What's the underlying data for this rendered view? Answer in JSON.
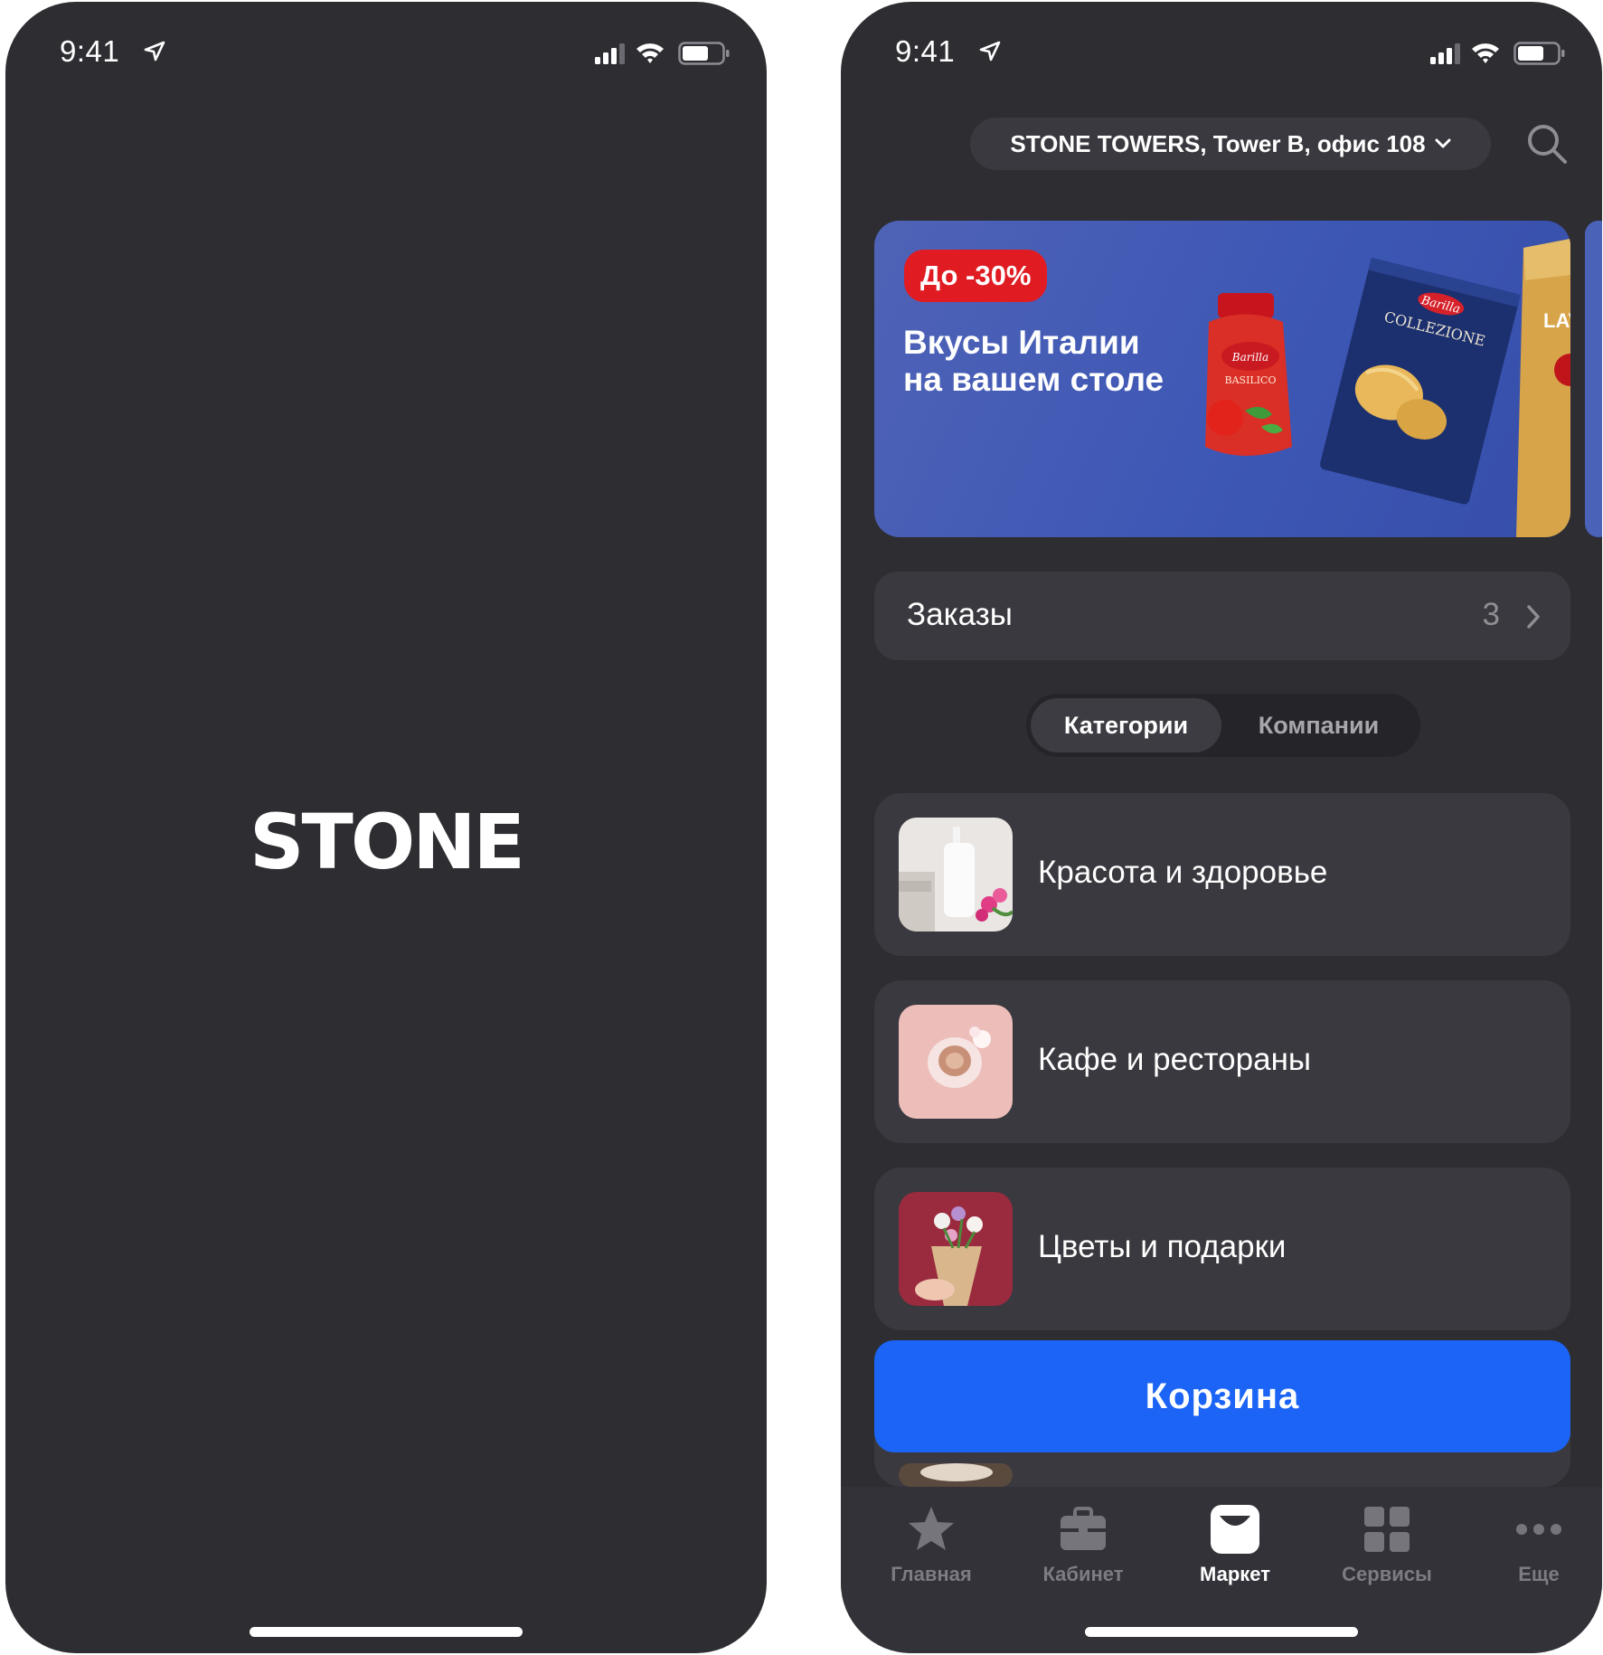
{
  "status_bar": {
    "time": "9:41"
  },
  "splash": {
    "logo_text": "STONE"
  },
  "market": {
    "address": "STONE TOWERS, Tower B, офис 108",
    "banner": {
      "badge": "До -30%",
      "title_line1": "Вкусы Италии",
      "title_line2": "на вашем столе",
      "product_labels": [
        "Barilla",
        "BASILICO",
        "COLLEZIONE",
        "LAV"
      ]
    },
    "orders": {
      "label": "Заказы",
      "count": "3"
    },
    "segments": {
      "active": "Категории",
      "inactive": "Компании"
    },
    "categories": [
      {
        "label": "Красота и здоровье"
      },
      {
        "label": "Кафе и рестораны"
      },
      {
        "label": "Цветы и подарки"
      }
    ],
    "cart_button": "Корзина"
  },
  "tab_bar": {
    "items": [
      {
        "label": "Главная",
        "icon": "star-icon"
      },
      {
        "label": "Кабинет",
        "icon": "briefcase-icon"
      },
      {
        "label": "Маркет",
        "icon": "bag-icon"
      },
      {
        "label": "Сервисы",
        "icon": "grid-icon"
      },
      {
        "label": "Еще",
        "icon": "more-icon"
      }
    ],
    "active_index": 2
  },
  "colors": {
    "background": "#2e2d32",
    "card": "#3a393f",
    "accent_blue": "#1b64f5",
    "badge_red": "#e01b22",
    "banner_blue": "#4a5fb6"
  }
}
